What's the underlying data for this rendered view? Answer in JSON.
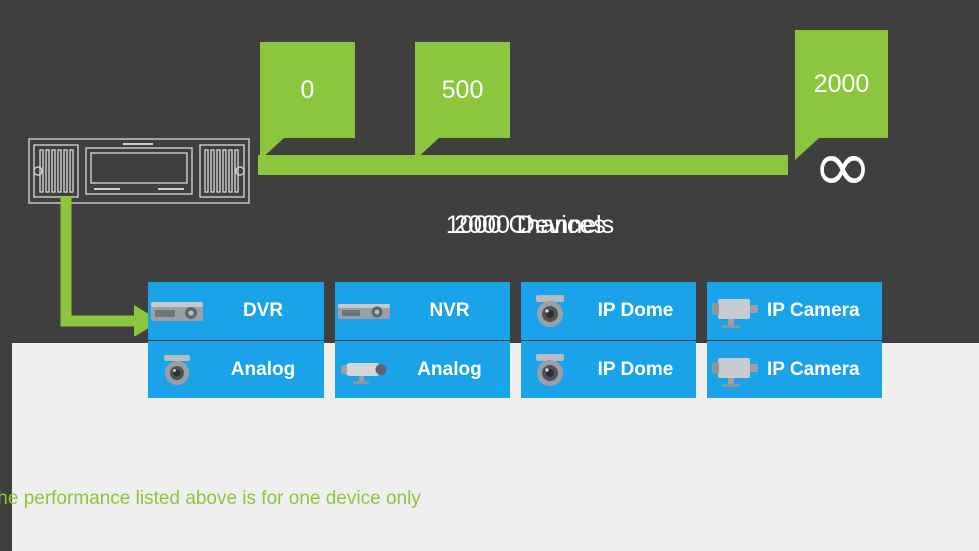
{
  "slide": {
    "background_color": "#3f3f3f",
    "lower_band_color": "#efefef",
    "accent_green": "#8cc63e",
    "tile_blue": "#1aa3e8"
  },
  "scale_bubbles": [
    {
      "value": "0"
    },
    {
      "value": "500"
    },
    {
      "value": "2000"
    }
  ],
  "infinity_symbol": "∞",
  "captions": [
    {
      "text": "2000 Devices"
    },
    {
      "text": "1000 Channels"
    }
  ],
  "tiles": [
    {
      "label": "DVR",
      "icon": "dvr-icon"
    },
    {
      "label": "NVR",
      "icon": "nvr-icon"
    },
    {
      "label": "IP Dome",
      "icon": "ip-dome-icon"
    },
    {
      "label": "IP Camera",
      "icon": "ip-camera-icon"
    },
    {
      "label": "Analog",
      "icon": "analog-dome-icon"
    },
    {
      "label": "Analog",
      "icon": "analog-bullet-icon"
    },
    {
      "label": "IP Dome",
      "icon": "ip-dome-icon"
    },
    {
      "label": "IP Camera",
      "icon": "ip-camera-icon"
    }
  ],
  "footnote": {
    "text": "the performance listed above is for one device only"
  }
}
